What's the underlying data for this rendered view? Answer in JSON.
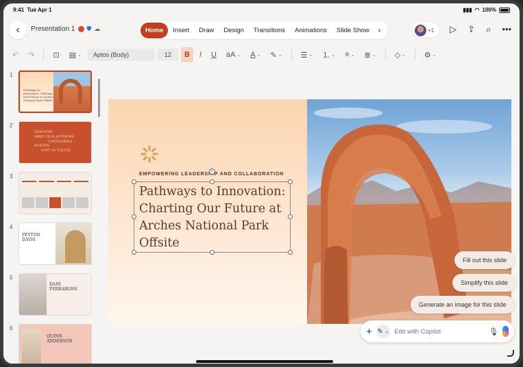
{
  "status": {
    "time": "9:41",
    "date": "Tue Apr 1",
    "battery": "100%"
  },
  "titlebar": {
    "doc_title": "Presentation 1",
    "tabs": [
      {
        "label": "Home",
        "active": true
      },
      {
        "label": "Insert"
      },
      {
        "label": "Draw"
      },
      {
        "label": "Design"
      },
      {
        "label": "Transitions"
      },
      {
        "label": "Animations"
      },
      {
        "label": "Slide Show"
      }
    ],
    "collaborators_extra": "+1"
  },
  "ribbon": {
    "font": "Aptos (Body)",
    "font_size": "12"
  },
  "thumbnails": [
    {
      "number": "1",
      "text": "Pathways to Innovation: Charting Our Future at Arches National Park Offsite",
      "selected": true
    },
    {
      "number": "2",
      "lines": [
        "SERVICES",
        "MEET OUR AUTHORS",
        "CATEGORIES",
        "EVENTS",
        "STAY IN TOUCH"
      ]
    },
    {
      "number": "3"
    },
    {
      "number": "4",
      "name_line1": "PEYTON",
      "name_line2": "DAVIS"
    },
    {
      "number": "5",
      "name_line1": "DANI",
      "name_line2": "FERRARONS"
    },
    {
      "number": "6",
      "name_line1": "QUINN",
      "name_line2": "ANDERSON"
    }
  ],
  "slide": {
    "kicker": "EMPOWERING LEADERSHIP AND COLLABORATION",
    "headline": "Pathways to Innovation: Charting Our Future at Arches National Park Offsite"
  },
  "copilot": {
    "suggestions": [
      "Fill out this slide",
      "Simplify this slide",
      "Generate an image for this slide"
    ],
    "placeholder": "Edit with Copilot"
  },
  "colors": {
    "accent": "#c43e1c"
  }
}
